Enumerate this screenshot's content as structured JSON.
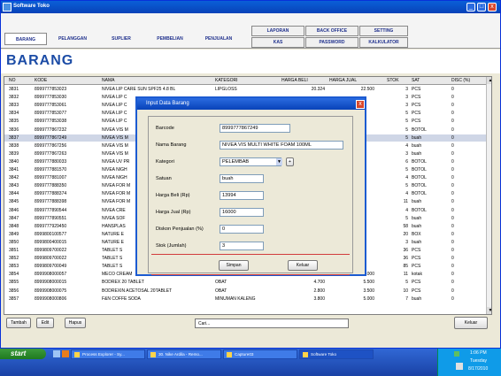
{
  "window": {
    "title": "Software Toko",
    "controls": {
      "min": "_",
      "max": "□",
      "close": "x"
    }
  },
  "menu": {
    "main": [
      "BARANG",
      "PELANGGAN",
      "SUPLIER",
      "PEMBELIAN",
      "PENJUALAN"
    ],
    "top_row": [
      "LAPORAN",
      "BACK OFFICE",
      "SETTING"
    ],
    "bottom_row": [
      "KAS",
      "PASSWORD",
      "KALKULATOR"
    ]
  },
  "page_title": "BARANG",
  "table": {
    "columns": [
      "NO",
      "KODE",
      "NAMA",
      "KATEGORI",
      "HARGA BELI",
      "HARGA JUAL",
      "STOK",
      "SAT",
      "DISC (%)"
    ],
    "rows": [
      [
        "3831",
        "8999777853023",
        "NIVEA LIP CARE SUN SPF25 4.8 BL",
        "LIPGLOSS",
        "20.324",
        "22.500",
        "3",
        "PCS",
        "0"
      ],
      [
        "3832",
        "8999777853030",
        "NIVEA LIP C",
        "",
        "",
        "",
        "3",
        "PCS",
        "0"
      ],
      [
        "3833",
        "8999777853061",
        "NIVEA LIP C",
        "",
        "",
        "",
        "3",
        "PCS",
        "0"
      ],
      [
        "3834",
        "8999777853077",
        "NIVEA LIP C",
        "",
        "",
        "",
        "5",
        "PCS",
        "0"
      ],
      [
        "3835",
        "8999777853038",
        "NIVEA LIP C",
        "",
        "",
        "",
        "5",
        "PCS",
        "0"
      ],
      [
        "3836",
        "8999777867232",
        "NIVEA VIS M",
        "",
        "",
        "",
        "5",
        "BOTOL",
        "0"
      ],
      [
        "3837",
        "8999777867249",
        "NIVEA VIS M",
        "",
        "",
        "",
        "5",
        "buah",
        "0"
      ],
      [
        "3838",
        "8999777867256",
        "NIVEA VIS M",
        "",
        "",
        "",
        "4",
        "buah",
        "0"
      ],
      [
        "3839",
        "8999777867263",
        "NIVEA VIS M",
        "",
        "",
        "",
        "3",
        "buah",
        "0"
      ],
      [
        "3840",
        "8999777880033",
        "NIVEA UV PR",
        "",
        "",
        "",
        "6",
        "BOTOL",
        "0"
      ],
      [
        "3841",
        "8999777881570",
        "NIVEA NIGH",
        "",
        "",
        "",
        "5",
        "BOTOL",
        "0"
      ],
      [
        "3842",
        "8999777881007",
        "NIVEA NIGH",
        "",
        "",
        "",
        "4",
        "BOTOL",
        "0"
      ],
      [
        "3843",
        "8999777888350",
        "NIVEA FOR M",
        "",
        "",
        "",
        "5",
        "BOTOL",
        "0"
      ],
      [
        "3844",
        "8999777888374",
        "NIVEA FOR M",
        "",
        "",
        "",
        "4",
        "BOTOL",
        "0"
      ],
      [
        "3845",
        "8999777888398",
        "NIVEA FOR M",
        "",
        "",
        "",
        "11",
        "buah",
        "0"
      ],
      [
        "3846",
        "8999777890544",
        "NIVEA CRE",
        "",
        "",
        "",
        "4",
        "BOTOL",
        "0"
      ],
      [
        "3847",
        "8999777890551",
        "NIVEA SOF",
        "",
        "",
        "",
        "5",
        "buah",
        "0"
      ],
      [
        "3848",
        "8999777929450",
        "HANSPLAS",
        "",
        "",
        "",
        "58",
        "buah",
        "0"
      ],
      [
        "3849",
        "8999800100577",
        "NATURE E",
        "",
        "",
        "",
        "20",
        "BOX",
        "0"
      ],
      [
        "3850",
        "8999800400015",
        "NATURE E",
        "",
        "",
        "",
        "3",
        "buah",
        "0"
      ],
      [
        "3851",
        "8999809700022",
        "TABLET S",
        "",
        "",
        "",
        "36",
        "PCS",
        "0"
      ],
      [
        "3852",
        "8999809700022",
        "TABLET S",
        "",
        "",
        "",
        "36",
        "PCS",
        "0"
      ],
      [
        "3853",
        "8999809700049",
        "TABLET S",
        "",
        "",
        "",
        "85",
        "PCS",
        "0"
      ],
      [
        "3854",
        "8999908000057",
        "MECO CREAM",
        "PELEMBAB MUKA",
        "11.300",
        "15.000",
        "11",
        "kotak",
        "0"
      ],
      [
        "3855",
        "8999908000015",
        "BODREX 20 TABLET",
        "OBAT",
        "4.700",
        "5.500",
        "5",
        "PCS",
        "0"
      ],
      [
        "3856",
        "8999908000075",
        "BODREXIN ACETOSAL 20TABLET",
        "OBAT",
        "2.800",
        "3.500",
        "10",
        "PCS",
        "0"
      ],
      [
        "3857",
        "8999908000806",
        "F&N COFFE SODA",
        "MINUMAN KALENG",
        "3.800",
        "5.000",
        "7",
        "buah",
        "0"
      ]
    ],
    "selected_index": 6
  },
  "buttons": {
    "tambah": "Tambah",
    "edit": "Edit",
    "hapus": "Hapus",
    "keluar": "Keluar"
  },
  "search": {
    "value": "Cari..."
  },
  "dialog": {
    "title": "Input Data Barang",
    "labels": {
      "barcode": "Barcode",
      "nama": "Nama Barang",
      "kategori": "Kategori",
      "satuan": "Satuan",
      "harga_beli": "Harga Beli (Rp)",
      "harga_jual": "Harga Jual (Rp)",
      "diskon": "Diskon Penjualan (%)",
      "stok": "Stok (Jumlah)"
    },
    "values": {
      "barcode": "8999777867249",
      "nama": "NIVEA VIS MULTI WHITE FOAM 100ML",
      "kategori": "PELEMBAB",
      "satuan": "buah",
      "harga_beli": "13994",
      "harga_jual": "16000",
      "diskon": "0",
      "stok": "3"
    },
    "buttons": {
      "simpan": "Simpan",
      "keluar": "Keluar",
      "add": "+"
    }
  },
  "taskbar": {
    "start": "start",
    "tasks": [
      "Process Explorer - Sy...",
      "30. Nike Ardila - Remo...",
      "Capture03",
      "Software Toko"
    ],
    "active_task": 3,
    "clock": {
      "time": "1:06 PM",
      "day": "Tuesday",
      "date": "8/17/2010"
    }
  }
}
